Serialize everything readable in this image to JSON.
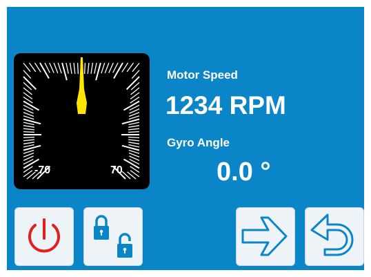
{
  "gauge": {
    "min_label": "-70",
    "max_label": "70",
    "needle_value": 0,
    "needle_color": "#ffe600"
  },
  "motor_speed": {
    "label": "Motor Speed",
    "value": "1234 RPM"
  },
  "gyro_angle": {
    "label": "Gyro Angle",
    "value": "0.0 °"
  },
  "buttons": [
    {
      "id": "power",
      "icon": "power-icon",
      "color": "#e02020"
    },
    {
      "id": "lock",
      "icon": "lock-unlock-icon",
      "color": "#0a86c8"
    },
    {
      "id": "next",
      "icon": "arrow-right-icon",
      "color": "#0a86c8"
    },
    {
      "id": "back",
      "icon": "undo-icon",
      "color": "#0a86c8"
    }
  ],
  "colors": {
    "background": "#0a86c8",
    "text": "#ffffff",
    "gauge_bg": "#000000"
  }
}
